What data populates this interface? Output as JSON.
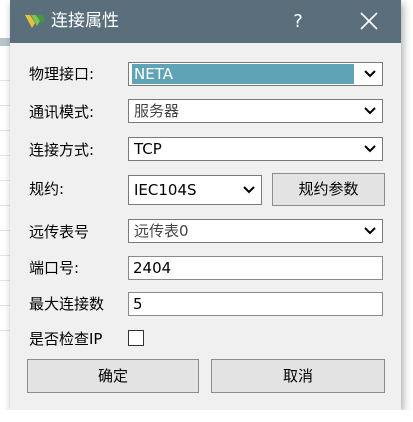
{
  "window": {
    "title": "连接属性",
    "help_glyph": "?",
    "icon": "app-logo-icon",
    "close_icon": "close-icon"
  },
  "form": {
    "physical_port": {
      "label": "物理接口:",
      "value": "NETA"
    },
    "comm_mode": {
      "label": "通讯模式:",
      "value": "服务器"
    },
    "conn_method": {
      "label": "连接方式:",
      "value": "TCP"
    },
    "protocol": {
      "label": "规约:",
      "value": "IEC104S",
      "params_button": "规约参数"
    },
    "remote_table": {
      "label": "远传表号",
      "value": "远传表0"
    },
    "port_number": {
      "label": "端口号:",
      "value": "2404"
    },
    "max_connections": {
      "label": "最大连接数",
      "value": "5"
    },
    "check_ip": {
      "label": "是否检查IP",
      "checked": false
    }
  },
  "buttons": {
    "ok": "确定",
    "cancel": "取消"
  },
  "colors": {
    "titlebar": "#5a6f7b",
    "selection": "#5fa3b6",
    "dialog_bg": "#f0f0f0"
  }
}
